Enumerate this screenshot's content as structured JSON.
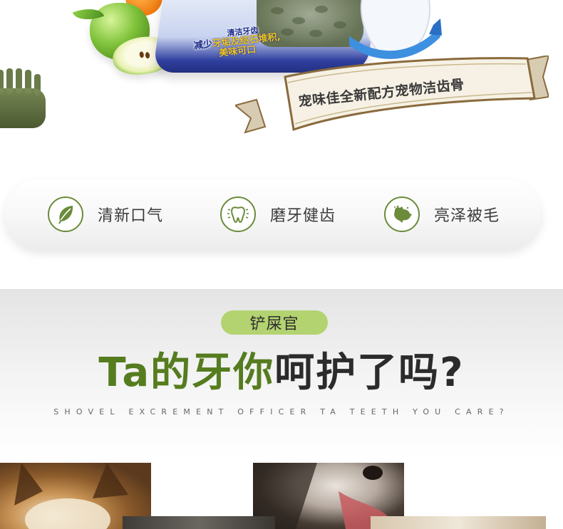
{
  "hero": {
    "box_label_small": "清洁牙齿",
    "box_label_line1": "减少",
    "box_label_line1_highlight": "牙垢及结石堆积,",
    "box_label_line2": "美味可口",
    "ribbon_text": "宠味佳全新配方宠物洁齿骨"
  },
  "features": [
    {
      "label": "清新口气",
      "icon": "leaf-icon"
    },
    {
      "label": "磨牙健齿",
      "icon": "tooth-icon"
    },
    {
      "label": "亮泽被毛",
      "icon": "dog-icon"
    }
  ],
  "section": {
    "tag": "铲屎官",
    "headline_green": "Ta的牙你",
    "headline_dark": "呵护了吗?",
    "subline": "SHOVEL EXCREMENT OFFICER TA TEETH YOU CARE?"
  },
  "colors": {
    "brand_green": "#557c1f",
    "pill_green": "#b3d370",
    "icon_ring": "#6a8b3a",
    "box_blue": "#2f3f9f"
  }
}
